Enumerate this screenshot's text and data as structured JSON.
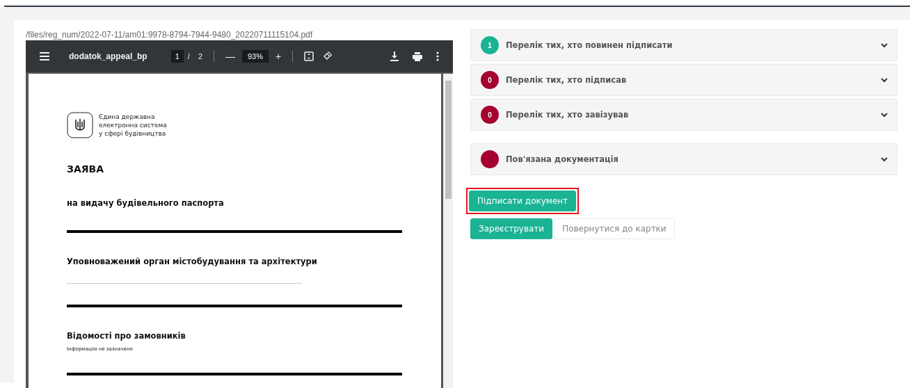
{
  "file_path": "/files/reg_num/2022-07-11/am01:9978-8794-7944-9480_20220711115104.pdf",
  "pdf_viewer": {
    "title": "dodatok_appeal_bp",
    "page": "1",
    "page_sep": "/",
    "page_count": "2",
    "zoom": "93%",
    "zoom_out": "—",
    "zoom_in": "+",
    "document": {
      "org_lines": [
        "Єдина державна",
        "електронна система",
        "у сфері будівництва"
      ],
      "blocks": [
        {
          "kind": "title",
          "text": "ЗАЯВА"
        },
        {
          "kind": "subtitle",
          "text": "на видачу будівельного паспорта"
        },
        {
          "kind": "rule"
        },
        {
          "kind": "heading",
          "text": "Уповноважений орган містобудування та архітектури"
        },
        {
          "kind": "blank"
        },
        {
          "kind": "rule"
        },
        {
          "kind": "heading",
          "text": "Відомості про замовників"
        },
        {
          "kind": "note",
          "text": "Інформацію не зазначено"
        },
        {
          "kind": "rule"
        }
      ]
    }
  },
  "panels": [
    {
      "count": "1",
      "color": "#1ab394",
      "label": "Перелік тих, хто повинен підписати",
      "expanded": false
    },
    {
      "count": "0",
      "color": "#a50030",
      "label": "Перелік тих, хто підписав",
      "expanded": false
    },
    {
      "count": "0",
      "color": "#a50030",
      "label": "Перелік тих, хто завізував",
      "expanded": false
    }
  ],
  "related_panels": [
    {
      "color": "#a50030",
      "label": "Пов'язана документація",
      "expanded": false
    }
  ],
  "sign_button": {
    "label": "Підписати документ",
    "highlighted": true
  },
  "buttons": [
    {
      "kind": "primary",
      "label": "Зареєструвати"
    },
    {
      "kind": "default",
      "label": "Повернутися до картки"
    }
  ]
}
